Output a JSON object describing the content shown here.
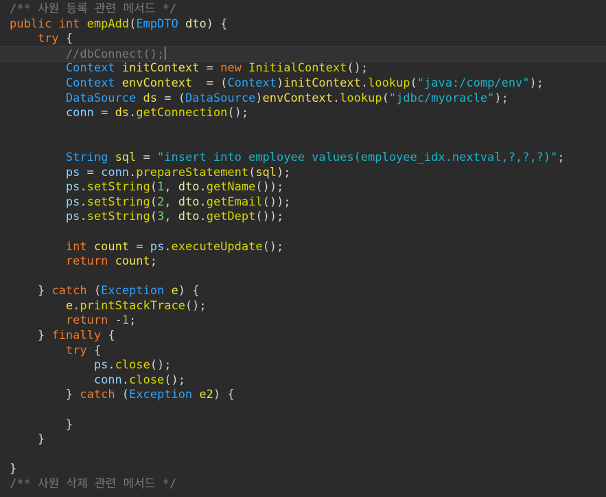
{
  "editor": {
    "lines": [
      [
        {
          "t": "/** 사원 등록 관련 메서드 */",
          "c": "cm"
        }
      ],
      [
        {
          "t": "public",
          "c": "kw"
        },
        {
          "t": " "
        },
        {
          "t": "int",
          "c": "kw"
        },
        {
          "t": " "
        },
        {
          "t": "empAdd",
          "c": "fn"
        },
        {
          "t": "(",
          "c": "pn"
        },
        {
          "t": "EmpDTO",
          "c": "ty"
        },
        {
          "t": " "
        },
        {
          "t": "dto",
          "c": "var"
        },
        {
          "t": ") {",
          "c": "pn"
        }
      ],
      [
        {
          "t": "    "
        },
        {
          "t": "try",
          "c": "kw"
        },
        {
          "t": " {",
          "c": "pn"
        }
      ],
      [
        {
          "t": "        "
        },
        {
          "t": "//dbConnect();",
          "c": "cm"
        }
      ],
      [
        {
          "t": "        "
        },
        {
          "t": "Context",
          "c": "ty"
        },
        {
          "t": " "
        },
        {
          "t": "initContext",
          "c": "lv"
        },
        {
          "t": " = ",
          "c": "pn"
        },
        {
          "t": "new",
          "c": "kw"
        },
        {
          "t": " "
        },
        {
          "t": "InitialContext",
          "c": "fn"
        },
        {
          "t": "();",
          "c": "pn"
        }
      ],
      [
        {
          "t": "        "
        },
        {
          "t": "Context",
          "c": "ty"
        },
        {
          "t": " "
        },
        {
          "t": "envContext",
          "c": "lv"
        },
        {
          "t": "  = (",
          "c": "pn"
        },
        {
          "t": "Context",
          "c": "ty"
        },
        {
          "t": ")",
          "c": "pn"
        },
        {
          "t": "initContext",
          "c": "lv"
        },
        {
          "t": ".",
          "c": "pn"
        },
        {
          "t": "lookup",
          "c": "fn"
        },
        {
          "t": "(",
          "c": "pn"
        },
        {
          "t": "\"java:/comp/env\"",
          "c": "str"
        },
        {
          "t": ");",
          "c": "pn"
        }
      ],
      [
        {
          "t": "        "
        },
        {
          "t": "DataSource",
          "c": "ty"
        },
        {
          "t": " "
        },
        {
          "t": "ds",
          "c": "lv"
        },
        {
          "t": " = (",
          "c": "pn"
        },
        {
          "t": "DataSource",
          "c": "ty"
        },
        {
          "t": ")",
          "c": "pn"
        },
        {
          "t": "envContext",
          "c": "lv"
        },
        {
          "t": ".",
          "c": "pn"
        },
        {
          "t": "lookup",
          "c": "fn"
        },
        {
          "t": "(",
          "c": "pn"
        },
        {
          "t": "\"jdbc/myoracle\"",
          "c": "str"
        },
        {
          "t": ");",
          "c": "pn"
        }
      ],
      [
        {
          "t": "        "
        },
        {
          "t": "conn",
          "c": "mth"
        },
        {
          "t": " = ",
          "c": "pn"
        },
        {
          "t": "ds",
          "c": "lv"
        },
        {
          "t": ".",
          "c": "pn"
        },
        {
          "t": "getConnection",
          "c": "fn"
        },
        {
          "t": "();",
          "c": "pn"
        }
      ],
      [],
      [],
      [
        {
          "t": "        "
        },
        {
          "t": "String",
          "c": "ty"
        },
        {
          "t": " "
        },
        {
          "t": "sql",
          "c": "lv"
        },
        {
          "t": " = ",
          "c": "pn"
        },
        {
          "t": "\"insert into employee values(employee_idx.nextval,?,?,?)\"",
          "c": "str"
        },
        {
          "t": ";",
          "c": "pn"
        }
      ],
      [
        {
          "t": "        "
        },
        {
          "t": "ps",
          "c": "mth"
        },
        {
          "t": " = ",
          "c": "pn"
        },
        {
          "t": "conn",
          "c": "mth"
        },
        {
          "t": ".",
          "c": "pn"
        },
        {
          "t": "prepareStatement",
          "c": "fn"
        },
        {
          "t": "(",
          "c": "pn"
        },
        {
          "t": "sql",
          "c": "lv"
        },
        {
          "t": ");",
          "c": "pn"
        }
      ],
      [
        {
          "t": "        "
        },
        {
          "t": "ps",
          "c": "mth"
        },
        {
          "t": ".",
          "c": "pn"
        },
        {
          "t": "setString",
          "c": "fn"
        },
        {
          "t": "(",
          "c": "pn"
        },
        {
          "t": "1",
          "c": "num"
        },
        {
          "t": ", ",
          "c": "pn"
        },
        {
          "t": "dto",
          "c": "var"
        },
        {
          "t": ".",
          "c": "pn"
        },
        {
          "t": "getName",
          "c": "fn"
        },
        {
          "t": "());",
          "c": "pn"
        }
      ],
      [
        {
          "t": "        "
        },
        {
          "t": "ps",
          "c": "mth"
        },
        {
          "t": ".",
          "c": "pn"
        },
        {
          "t": "setString",
          "c": "fn"
        },
        {
          "t": "(",
          "c": "pn"
        },
        {
          "t": "2",
          "c": "num"
        },
        {
          "t": ", ",
          "c": "pn"
        },
        {
          "t": "dto",
          "c": "var"
        },
        {
          "t": ".",
          "c": "pn"
        },
        {
          "t": "getEmail",
          "c": "fn"
        },
        {
          "t": "());",
          "c": "pn"
        }
      ],
      [
        {
          "t": "        "
        },
        {
          "t": "ps",
          "c": "mth"
        },
        {
          "t": ".",
          "c": "pn"
        },
        {
          "t": "setString",
          "c": "fn"
        },
        {
          "t": "(",
          "c": "pn"
        },
        {
          "t": "3",
          "c": "num"
        },
        {
          "t": ", ",
          "c": "pn"
        },
        {
          "t": "dto",
          "c": "var"
        },
        {
          "t": ".",
          "c": "pn"
        },
        {
          "t": "getDept",
          "c": "fn"
        },
        {
          "t": "());",
          "c": "pn"
        }
      ],
      [],
      [
        {
          "t": "        "
        },
        {
          "t": "int",
          "c": "kw"
        },
        {
          "t": " "
        },
        {
          "t": "count",
          "c": "lv"
        },
        {
          "t": " = ",
          "c": "pn"
        },
        {
          "t": "ps",
          "c": "mth"
        },
        {
          "t": ".",
          "c": "pn"
        },
        {
          "t": "executeUpdate",
          "c": "fn"
        },
        {
          "t": "();",
          "c": "pn"
        }
      ],
      [
        {
          "t": "        "
        },
        {
          "t": "return",
          "c": "kw"
        },
        {
          "t": " "
        },
        {
          "t": "count",
          "c": "lv"
        },
        {
          "t": ";",
          "c": "pn"
        }
      ],
      [],
      [
        {
          "t": "    "
        },
        {
          "t": "} ",
          "c": "pn"
        },
        {
          "t": "catch",
          "c": "kw"
        },
        {
          "t": " (",
          "c": "pn"
        },
        {
          "t": "Exception",
          "c": "ty"
        },
        {
          "t": " "
        },
        {
          "t": "e",
          "c": "lv"
        },
        {
          "t": ") {",
          "c": "pn"
        }
      ],
      [
        {
          "t": "        "
        },
        {
          "t": "e",
          "c": "lv"
        },
        {
          "t": ".",
          "c": "pn"
        },
        {
          "t": "printStackTrace",
          "c": "fn"
        },
        {
          "t": "();",
          "c": "pn"
        }
      ],
      [
        {
          "t": "        "
        },
        {
          "t": "return",
          "c": "kw"
        },
        {
          "t": " -",
          "c": "pn"
        },
        {
          "t": "1",
          "c": "num"
        },
        {
          "t": ";",
          "c": "pn"
        }
      ],
      [
        {
          "t": "    "
        },
        {
          "t": "} ",
          "c": "pn"
        },
        {
          "t": "finally",
          "c": "kw"
        },
        {
          "t": " {",
          "c": "pn"
        }
      ],
      [
        {
          "t": "        "
        },
        {
          "t": "try",
          "c": "kw"
        },
        {
          "t": " {",
          "c": "pn"
        }
      ],
      [
        {
          "t": "            "
        },
        {
          "t": "ps",
          "c": "mth"
        },
        {
          "t": ".",
          "c": "pn"
        },
        {
          "t": "close",
          "c": "fn"
        },
        {
          "t": "();",
          "c": "pn"
        }
      ],
      [
        {
          "t": "            "
        },
        {
          "t": "conn",
          "c": "mth"
        },
        {
          "t": ".",
          "c": "pn"
        },
        {
          "t": "close",
          "c": "fn"
        },
        {
          "t": "();",
          "c": "pn"
        }
      ],
      [
        {
          "t": "        "
        },
        {
          "t": "} ",
          "c": "pn"
        },
        {
          "t": "catch",
          "c": "kw"
        },
        {
          "t": " (",
          "c": "pn"
        },
        {
          "t": "Exception",
          "c": "ty"
        },
        {
          "t": " "
        },
        {
          "t": "e2",
          "c": "lv"
        },
        {
          "t": ") {",
          "c": "pn"
        }
      ],
      [],
      [
        {
          "t": "        "
        },
        {
          "t": "}",
          "c": "pn"
        }
      ],
      [
        {
          "t": "    "
        },
        {
          "t": "}",
          "c": "pn"
        }
      ],
      [],
      [
        {
          "t": "}",
          "c": "pn"
        }
      ],
      [
        {
          "t": "/** 사원 삭제 관련 메서드 */",
          "c": "cm"
        }
      ]
    ]
  }
}
